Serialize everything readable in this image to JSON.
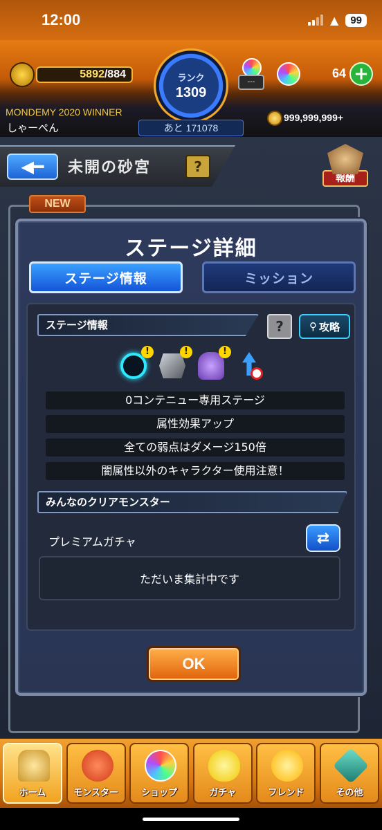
{
  "status_bar": {
    "time": "12:00",
    "battery": "99"
  },
  "header": {
    "stamina_current": "5892",
    "stamina_max": "/884",
    "rank_label": "ランク",
    "rank_value": "1309",
    "rank_next": "あと 171078",
    "orb_stand_value": "---",
    "orb_count": "64",
    "winner_title": "MONDEMY 2020 WINNER",
    "player_name": "しゃーぺん",
    "coin_count": "999,999,999+"
  },
  "nav": {
    "stage_name": "未開の砂宮",
    "help_label": "?",
    "reward_label": "報酬",
    "new_tag": "NEW"
  },
  "modal": {
    "title": "ステージ詳細",
    "tabs": [
      {
        "label": "ステージ情報",
        "active": true
      },
      {
        "label": "ミッション",
        "active": false
      }
    ],
    "stage_info_header": "ステージ情報",
    "help_label": "?",
    "strategy_label": "攻略",
    "gimmicks": [
      "barrier-ring",
      "block",
      "cannon",
      "speed-down"
    ],
    "info_rows": [
      "0コンテニュー専用ステージ",
      "属性効果アップ",
      "全ての弱点はダメージ150倍",
      "闇属性以外のキャラクター使用注意！"
    ],
    "clear_monsters_header": "みんなのクリアモンスター",
    "gacha_label": "プレミアムガチャ",
    "tally_text": "ただいま集計中です",
    "ok_label": "OK"
  },
  "bottom_nav": [
    {
      "label": "ホーム",
      "icon": "home-icon",
      "color": "#c9952a"
    },
    {
      "label": "モンスター",
      "icon": "monster-icon",
      "color": "#d03a1a"
    },
    {
      "label": "ショップ",
      "icon": "rainbow-orb-icon",
      "color": "#7fd0ff"
    },
    {
      "label": "ガチャ",
      "icon": "gacha-egg-icon",
      "color": "#ffe84a"
    },
    {
      "label": "フレンド",
      "icon": "friends-icon",
      "color": "#ffd23a"
    },
    {
      "label": "その他",
      "icon": "other-icon",
      "color": "#3ab0a0"
    }
  ]
}
